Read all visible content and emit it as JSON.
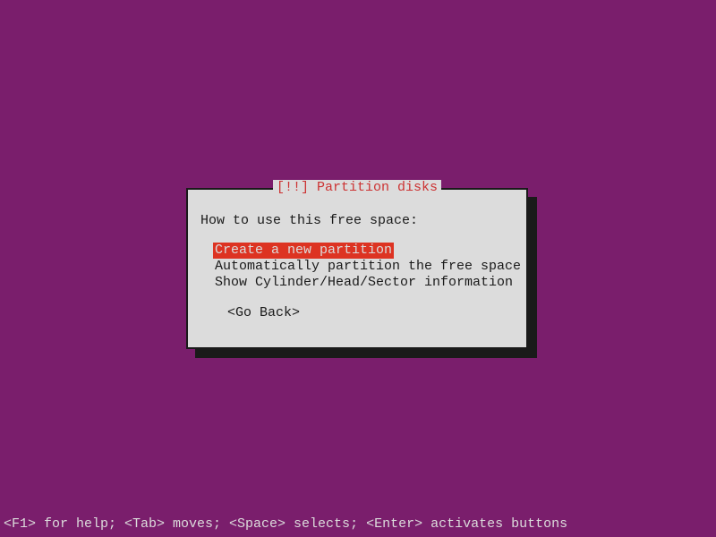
{
  "dialog": {
    "title_prefix": "[!!]",
    "title": "Partition disks",
    "prompt": "How to use this free space:",
    "options": [
      {
        "label": "Create a new partition",
        "selected": true
      },
      {
        "label": "Automatically partition the free space",
        "selected": false
      },
      {
        "label": "Show Cylinder/Head/Sector information",
        "selected": false
      }
    ],
    "go_back": "<Go Back>"
  },
  "footer": "<F1> for help; <Tab> moves; <Space> selects; <Enter> activates buttons"
}
